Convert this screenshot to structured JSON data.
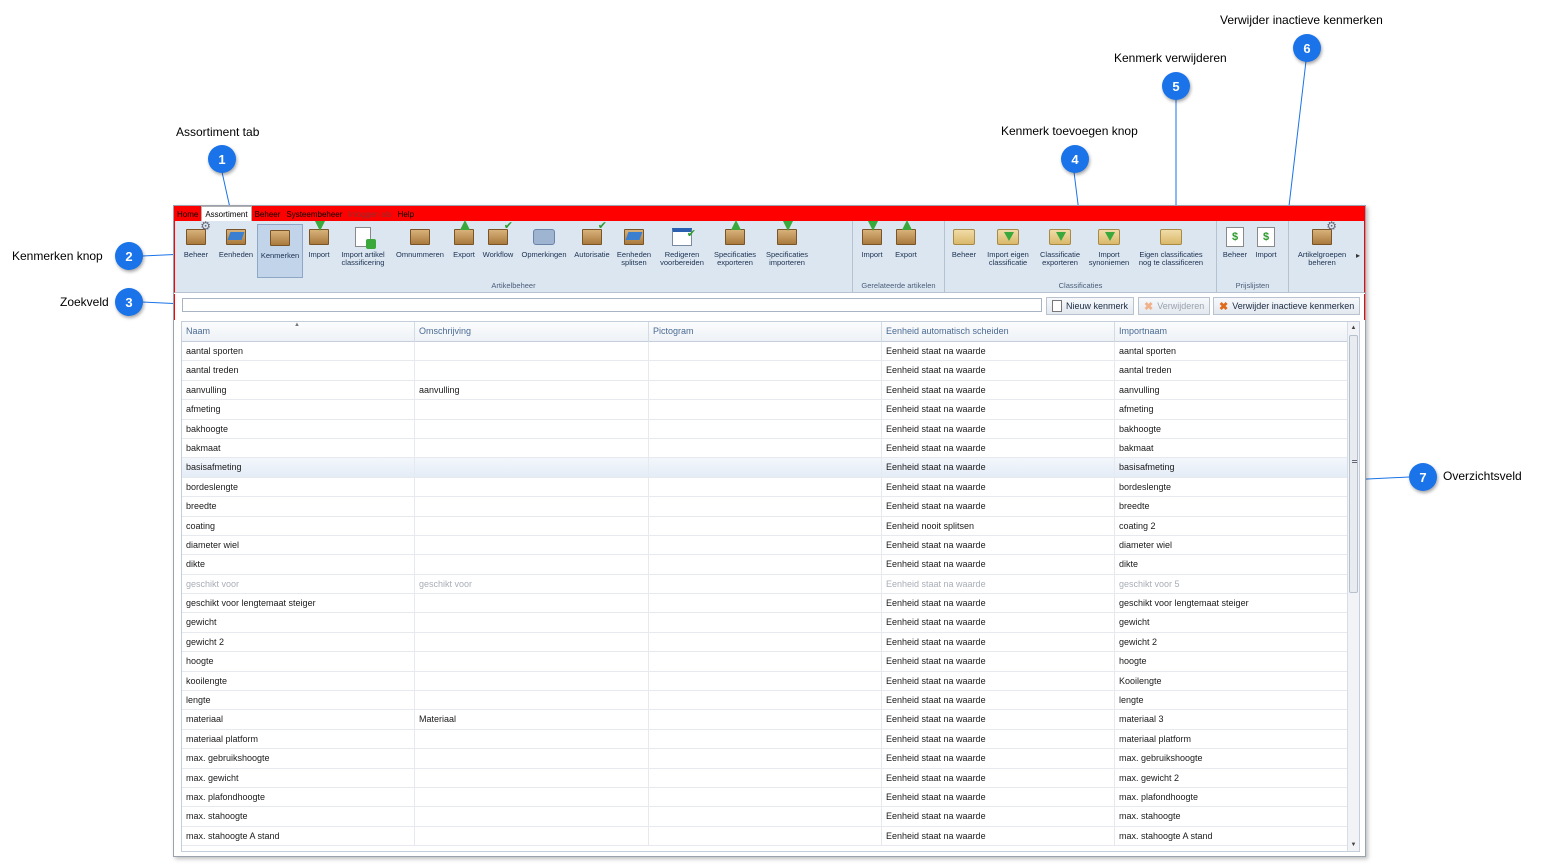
{
  "callouts": [
    {
      "num": "1",
      "label": "Assortiment tab"
    },
    {
      "num": "2",
      "label": "Kenmerken knop"
    },
    {
      "num": "3",
      "label": "Zoekveld"
    },
    {
      "num": "4",
      "label": "Kenmerk toevoegen knop"
    },
    {
      "num": "5",
      "label": "Kenmerk verwijderen"
    },
    {
      "num": "6",
      "label": "Verwijder inactieve kenmerken"
    },
    {
      "num": "7",
      "label": "Overzichtsveld"
    }
  ],
  "menu": {
    "tabs": [
      "Home",
      "Assortiment",
      "Beheer",
      "Systeembeheer",
      "Inloggen als",
      "Help"
    ],
    "active": "Assortiment"
  },
  "ribbon": {
    "artikelbeheer": {
      "label": "Artikelbeheer",
      "buttons": [
        {
          "line1": "Beheer",
          "line2": "",
          "icon": "box-gear-icon"
        },
        {
          "line1": "Eenheden",
          "line2": "",
          "icon": "box-blue-icon"
        },
        {
          "line1": "Kenmerken",
          "line2": "",
          "icon": "box-doc-icon",
          "selected": true
        },
        {
          "line1": "Import",
          "line2": "",
          "icon": "box-import-icon"
        },
        {
          "line1": "Import artikel",
          "line2": "classificering",
          "icon": "doc-import-icon"
        },
        {
          "line1": "Omnummeren",
          "line2": "",
          "icon": "box-renumber-icon"
        },
        {
          "line1": "Export",
          "line2": "",
          "icon": "box-export-icon"
        },
        {
          "line1": "Workflow",
          "line2": "",
          "icon": "workflow-icon"
        },
        {
          "line1": "Opmerkingen",
          "line2": "",
          "icon": "comment-icon"
        },
        {
          "line1": "Autorisatie",
          "line2": "",
          "icon": "box-check-icon"
        },
        {
          "line1": "Eenheden",
          "line2": "splitsen",
          "icon": "box-split-icon"
        },
        {
          "line1": "Redigeren",
          "line2": "voorbereiden",
          "icon": "calendar-check-icon"
        },
        {
          "line1": "Specificaties",
          "line2": "exporteren",
          "icon": "box-export-icon"
        },
        {
          "line1": "Specificaties",
          "line2": "importeren",
          "icon": "box-import-icon"
        }
      ]
    },
    "gerelateerde": {
      "label": "Gerelateerde artikelen",
      "buttons": [
        {
          "line1": "Import",
          "line2": "",
          "icon": "box-import-icon"
        },
        {
          "line1": "Export",
          "line2": "",
          "icon": "box-export-icon"
        }
      ]
    },
    "classificaties": {
      "label": "Classificaties",
      "buttons": [
        {
          "line1": "Beheer",
          "line2": "",
          "icon": "folder-icon"
        },
        {
          "line1": "Import eigen",
          "line2": "classificatie",
          "icon": "folder-import-icon"
        },
        {
          "line1": "Classificatie",
          "line2": "exporteren",
          "icon": "folder-export-icon"
        },
        {
          "line1": "Import",
          "line2": "synoniemen",
          "icon": "folder-import-icon"
        },
        {
          "line1": "Eigen classificaties",
          "line2": "nog te classificeren",
          "icon": "folder-icon"
        }
      ]
    },
    "prijslijsten": {
      "label": "Prijslijsten",
      "buttons": [
        {
          "line1": "Beheer",
          "line2": "",
          "icon": "dollar-edit-icon"
        },
        {
          "line1": "Import",
          "line2": "",
          "icon": "dollar-import-icon"
        }
      ]
    },
    "overig": {
      "label": "",
      "buttons": [
        {
          "line1": "Artikelgroepen",
          "line2": "beheren",
          "icon": "box-gear-icon"
        }
      ]
    }
  },
  "search": {
    "value": "",
    "placeholder": ""
  },
  "toolbar": {
    "new_label": "Nieuw kenmerk",
    "delete_label": "Verwijderen",
    "delete_inactive_label": "Verwijder inactieve kenmerken"
  },
  "grid": {
    "columns": [
      "Naam",
      "Omschrijving",
      "Pictogram",
      "Eenheid automatisch scheiden",
      "Importnaam"
    ],
    "rows": [
      [
        "aantal sporten",
        "",
        "",
        "Eenheid staat na waarde",
        "aantal sporten"
      ],
      [
        "aantal treden",
        "",
        "",
        "Eenheid staat na waarde",
        "aantal treden"
      ],
      [
        "aanvulling",
        "aanvulling",
        "",
        "Eenheid staat na waarde",
        "aanvulling"
      ],
      [
        "afmeting",
        "",
        "",
        "Eenheid staat na waarde",
        "afmeting"
      ],
      [
        "bakhoogte",
        "",
        "",
        "Eenheid staat na waarde",
        "bakhoogte"
      ],
      [
        "bakmaat",
        "",
        "",
        "Eenheid staat na waarde",
        "bakmaat"
      ],
      [
        "basisafmeting",
        "",
        "",
        "Eenheid staat na waarde",
        "basisafmeting"
      ],
      [
        "bordeslengte",
        "",
        "",
        "Eenheid staat na waarde",
        "bordeslengte"
      ],
      [
        "breedte",
        "",
        "",
        "Eenheid staat na waarde",
        "breedte"
      ],
      [
        "coating",
        "",
        "",
        "Eenheid nooit splitsen",
        "coating 2"
      ],
      [
        "diameter wiel",
        "",
        "",
        "Eenheid staat na waarde",
        "diameter wiel"
      ],
      [
        "dikte",
        "",
        "",
        "Eenheid staat na waarde",
        "dikte"
      ],
      [
        "geschikt voor",
        "geschikt voor",
        "",
        "Eenheid staat na waarde",
        "geschikt voor 5"
      ],
      [
        "geschikt voor lengtemaat steiger",
        "",
        "",
        "Eenheid staat na waarde",
        "geschikt voor lengtemaat steiger"
      ],
      [
        "gewicht",
        "",
        "",
        "Eenheid staat na waarde",
        "gewicht"
      ],
      [
        "gewicht 2",
        "",
        "",
        "Eenheid staat na waarde",
        "gewicht 2"
      ],
      [
        "hoogte",
        "",
        "",
        "Eenheid staat na waarde",
        "hoogte"
      ],
      [
        "kooilengte",
        "",
        "",
        "Eenheid staat na waarde",
        "Kooilengte"
      ],
      [
        "lengte",
        "",
        "",
        "Eenheid staat na waarde",
        "lengte"
      ],
      [
        "materiaal",
        "Materiaal",
        "",
        "Eenheid staat na waarde",
        "materiaal 3"
      ],
      [
        "materiaal platform",
        "",
        "",
        "Eenheid staat na waarde",
        "materiaal platform"
      ],
      [
        "max. gebruikshoogte",
        "",
        "",
        "Eenheid staat na waarde",
        "max. gebruikshoogte"
      ],
      [
        "max. gewicht",
        "",
        "",
        "Eenheid staat na waarde",
        "max. gewicht 2"
      ],
      [
        "max. plafondhoogte",
        "",
        "",
        "Eenheid staat na waarde",
        "max. plafondhoogte"
      ],
      [
        "max. stahoogte",
        "",
        "",
        "Eenheid staat na waarde",
        "max. stahoogte"
      ],
      [
        "max. stahoogte A stand",
        "",
        "",
        "Eenheid staat na waarde",
        "max. stahoogte A stand"
      ]
    ],
    "selected_row": 6,
    "inactive_row": 12
  },
  "colors": {
    "accent": "#1a73e8",
    "menubar": "#ff0000",
    "ribbon": "#dce6f1",
    "header_text": "#4a6a94"
  }
}
